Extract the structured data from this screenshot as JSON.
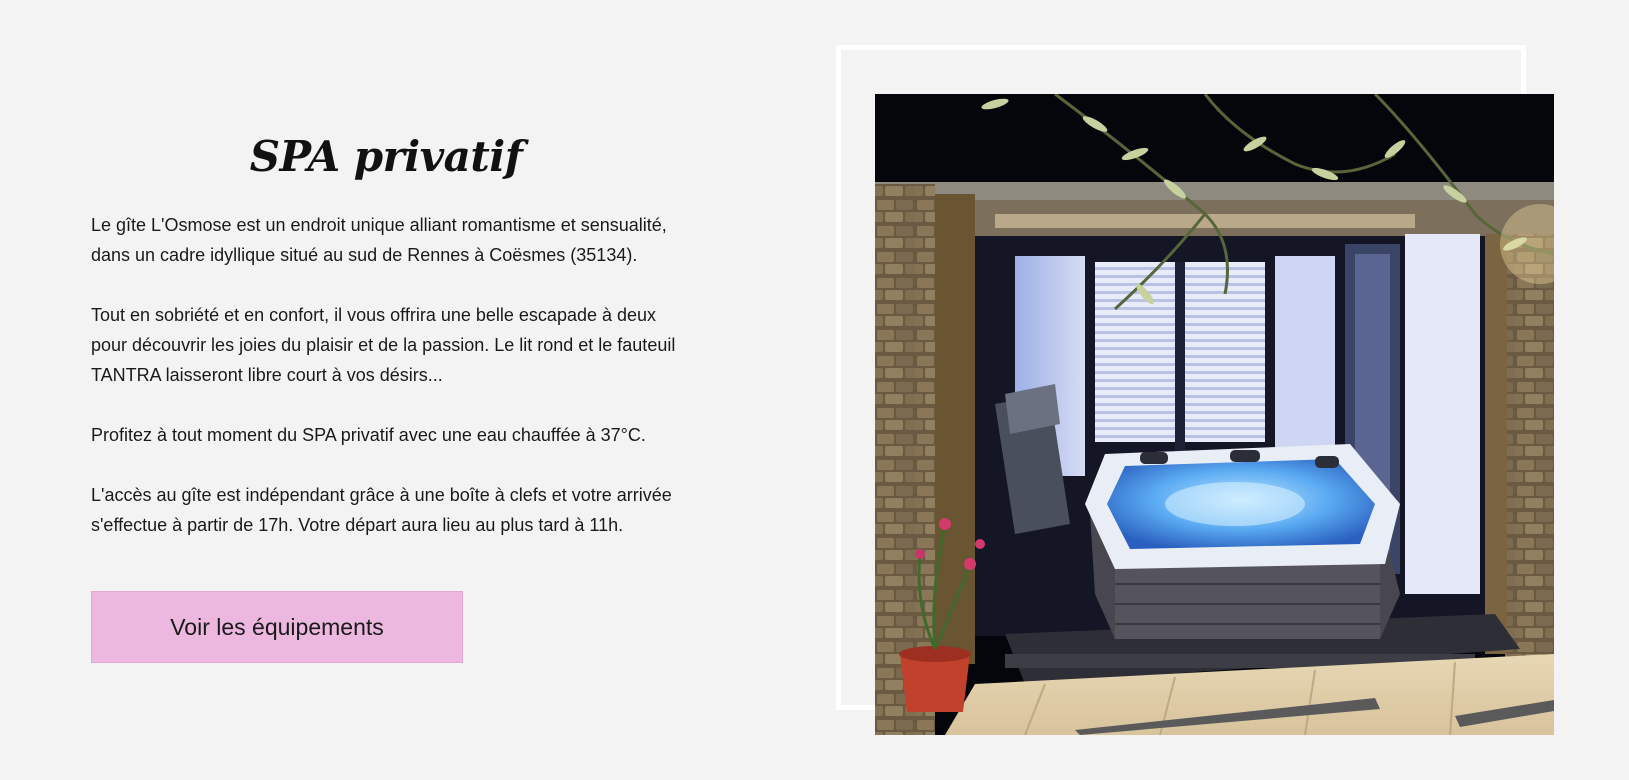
{
  "section": {
    "title": "SPA privatif",
    "paragraphs": [
      "Le gîte L'Osmose est un endroit unique alliant romantisme et sensualité, dans un cadre idyllique situé au sud de Rennes à Coësmes (35134).",
      "Tout en sobriété et en confort, il vous offrira une belle escapade à deux pour découvrir les joies du plaisir et de la passion. Le lit rond et le fauteuil TANTRA laisseront libre court à vos désirs...",
      "Profitez à tout moment du SPA privatif avec une eau chauffée à 37°C.",
      "L'accès au gîte est indépendant grâce à une boîte à clefs et votre arrivée s'effectue à partir de 17h. Votre départ aura lieu au plus tard à 11h."
    ],
    "button_label": "Voir les équipements"
  },
  "colors": {
    "background": "#f3f3f3",
    "button": "#edb8df",
    "frame": "#ffffff",
    "text": "#111111"
  },
  "image": {
    "subject": "hot-tub-spa-at-night"
  }
}
